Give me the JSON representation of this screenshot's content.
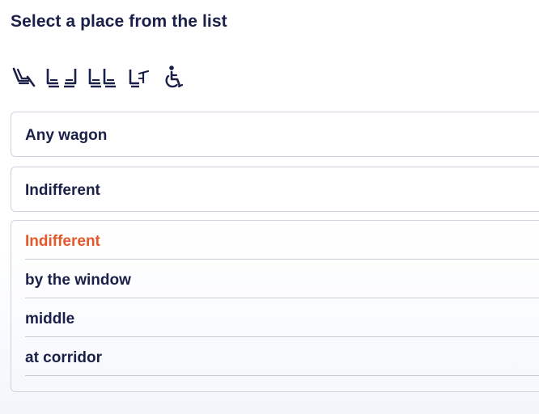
{
  "header": {
    "title": "Select a place from the list"
  },
  "seat_type_icons": [
    {
      "icon": "reclining-seat-icon"
    },
    {
      "icon": "seats-facing-apart-icon"
    },
    {
      "icon": "seats-side-by-side-icon"
    },
    {
      "icon": "seat-with-table-icon"
    },
    {
      "icon": "wheelchair-icon"
    }
  ],
  "wagon_select": {
    "value": "Any wagon"
  },
  "position_select": {
    "value": "Indifferent"
  },
  "position_options": [
    {
      "label": "Indifferent",
      "selected": true
    },
    {
      "label": "by the window",
      "selected": false
    },
    {
      "label": "middle",
      "selected": false
    },
    {
      "label": "at corridor",
      "selected": false
    }
  ],
  "colors": {
    "text": "#1b2048",
    "accent": "#e4582b",
    "border": "#cfd2dc"
  }
}
